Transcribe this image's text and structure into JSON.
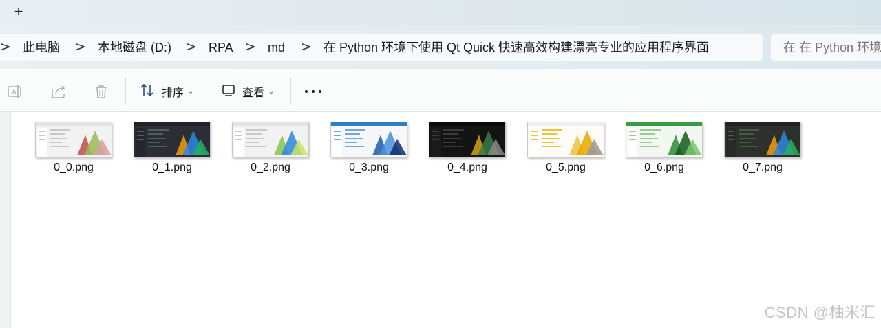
{
  "tabbar": {
    "add_tab_glyph": "+"
  },
  "address": {
    "crumbs": [
      "此电脑",
      "本地磁盘 (D:)",
      "RPA",
      "md",
      "在 Python 环境下使用 Qt Quick 快速高效构建漂亮专业的应用程序界面"
    ],
    "separator": ">"
  },
  "search": {
    "placeholder": "在 在 Python 环境"
  },
  "toolbar": {
    "sort_label": "排序",
    "view_label": "查看",
    "icons": [
      "rename-icon",
      "share-icon",
      "delete-icon",
      "sort-icon",
      "view-icon",
      "more-icon"
    ]
  },
  "files": [
    {
      "name": "0_0.png",
      "theme": "light",
      "accent": "#c0504d"
    },
    {
      "name": "0_1.png",
      "theme": "dark",
      "accent": "#f39c12"
    },
    {
      "name": "0_2.png",
      "theme": "light",
      "accent": "#8bc34a"
    },
    {
      "name": "0_3.png",
      "theme": "blue",
      "accent": "#1e5aa8"
    },
    {
      "name": "0_4.png",
      "theme": "black",
      "accent": "#d4a017"
    },
    {
      "name": "0_5.png",
      "theme": "cream",
      "accent": "#f0c040"
    },
    {
      "name": "0_6.png",
      "theme": "green",
      "accent": "#2e8b3a"
    },
    {
      "name": "0_7.png",
      "theme": "darkgreen",
      "accent": "#f39c12"
    }
  ],
  "watermark": "CSDN @柚米汇"
}
